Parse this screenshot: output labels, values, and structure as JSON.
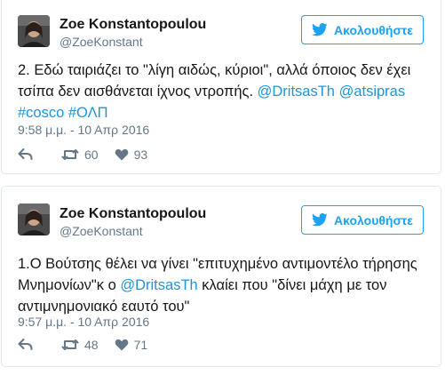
{
  "tweets": [
    {
      "name": "Zoe Konstantopoulou",
      "handle": "@ZoeKonstant",
      "follow_label": "Ακολουθήστε",
      "text_parts": [
        "2. Εδώ ταιριάζει το \"λίγη αιδώς, κύριοι\", αλλά όποιος δεν έχει τσίπα δεν αισθάνεται ίχνος ντροπής. ",
        "@DritsasTh",
        " ",
        "@atsipras",
        " ",
        "#cosco",
        " ",
        "#ΟΛΠ"
      ],
      "timestamp": "9:58 μ.μ. - 10 Απρ 2016",
      "retweets": "60",
      "likes": "93"
    },
    {
      "name": "Zoe Konstantopoulou",
      "handle": "@ZoeKonstant",
      "follow_label": "Ακολουθήστε",
      "text_parts": [
        "1.Ο Βούτσης θέλει να γίνει \"επιτυχημένο αντιμοντέλο τήρησης Μνημονίων\"κ ο ",
        "@DritsasTh",
        " κλαίει που \"δίνει μάχη με τον αντιμνημονιακό εαυτό του\""
      ],
      "timestamp": "9:57 μ.μ. - 10 Απρ 2016",
      "retweets": "48",
      "likes": "71"
    }
  ],
  "colors": {
    "accent": "#1da1f2",
    "link": "#1b95e0",
    "muted": "#657786",
    "border": "#e1e8ed"
  },
  "icons": {
    "follow": "twitter-bird-icon",
    "reply": "reply-icon",
    "retweet": "retweet-icon",
    "like": "heart-icon"
  }
}
